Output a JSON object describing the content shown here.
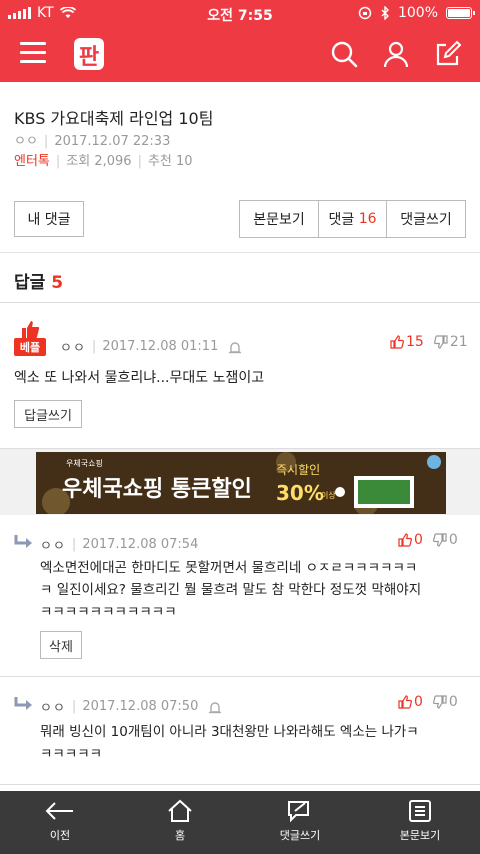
{
  "status": {
    "carrier": "KT",
    "time": "오전 7:55",
    "battery": "100%"
  },
  "header": {
    "logo_text": "판"
  },
  "article": {
    "title": "KBS 가요대축제 라인업 10팀",
    "author": "ㅇㅇ",
    "datetime": "2017.12.07 22:33",
    "category": "엔터톡",
    "views_label": "조회 2,096",
    "recommend_label": "추천 10"
  },
  "buttons": {
    "my_comments": "내 댓글",
    "view_post": "본문보기",
    "comments_label": "댓글",
    "comments_count": "16",
    "write_comment": "댓글쓰기"
  },
  "replies_header": {
    "label": "답글",
    "count": "5"
  },
  "best_comment": {
    "badge": "베플",
    "author": "ㅇㅇ",
    "datetime": "2017.12.08 01:11",
    "up": "15",
    "down": "21",
    "text": "엑소 또 나와서 물흐리냐...무대도 노잼이고",
    "reply_button": "답글쓰기"
  },
  "ad": {
    "brand_small": "우체국쇼핑",
    "main_text": "우체국쇼핑 통큰할인",
    "promo_top": "즉시할인",
    "promo_pct": "30%",
    "promo_suffix": "이상"
  },
  "replies": [
    {
      "author": "ㅇㅇ",
      "datetime": "2017.12.08 07:54",
      "up": "0",
      "down": "0",
      "line1": "엑소면전에대곤 한마디도 못할꺼면서 물흐리네 ㅇㅈㄹㅋㅋㅋㅋㅋㅋ",
      "line2": "ㅋ 일진이세요? 물흐리긴 뭘 물흐려 말도 참 막한다 정도껏 막해야지",
      "line3": "ㅋㅋㅋㅋㅋㅋㅋㅋㅋㅋㅋ",
      "delete_button": "삭제"
    },
    {
      "author": "ㅇㅇ",
      "datetime": "2017.12.08 07:50",
      "up": "0",
      "down": "0",
      "line1": "뭐래 빙신이 10개팀이 아니라 3대천왕만 나와라해도 엑소는 나가ㅋ",
      "line2": "ㅋㅋㅋㅋㅋ"
    }
  ],
  "bottom_nav": {
    "prev": "이전",
    "home": "홈",
    "write": "댓글쓰기",
    "view": "본문보기"
  },
  "colors": {
    "brand": "#ee3a43",
    "accent_red": "#e32",
    "nav_bg": "#3a3a3a"
  }
}
